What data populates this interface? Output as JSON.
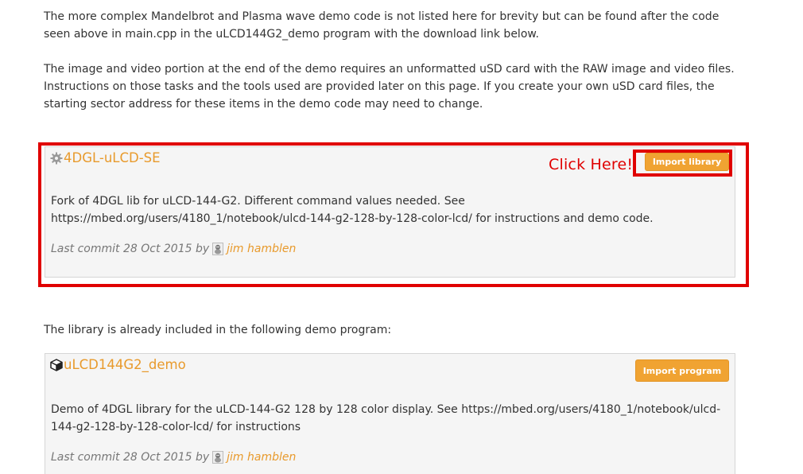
{
  "intro": {
    "paragraph1": "The more complex Mandelbrot and Plasma wave demo code is not listed here for brevity but can be found after the code seen above in main.cpp in the uLCD144G2_demo program with the download link below.",
    "paragraph2": "The image and video portion at the end of the demo requires an unformatted uSD card with the RAW image and video files. Instructions on those tasks and the tools used are provided later on this page. If you create your own uSD card files, the starting sector address for these items in the demo code may need to change."
  },
  "library_card": {
    "icon": "gear-icon",
    "title": "4DGL-uLCD-SE",
    "button_label": "Import library",
    "annotation": "Click Here!",
    "description": "Fork of 4DGL lib for uLCD-144-G2. Different command values needed. See https://mbed.org/users/4180_1/notebook/ulcd-144-g2-128-by-128-color-lcd/ for instructions and demo code.",
    "commit_prefix": "Last commit 28 Oct 2015 by",
    "author": "jim hamblen"
  },
  "included_text": "The library is already included in the following demo program:",
  "program_card": {
    "icon": "cube-icon",
    "title": "uLCD144G2_demo",
    "button_label": "Import program",
    "description": "Demo of 4DGL library for the uLCD-144-G2 128 by 128 color display. See https://mbed.org/users/4180_1/notebook/ulcd-144-g2-128-by-128-color-lcd/ for instructions",
    "commit_prefix": "Last commit 28 Oct 2015 by",
    "author": "jim hamblen"
  },
  "colors": {
    "accent": "#e89a2c",
    "button": "#f0a332",
    "annotation_red": "#e00000",
    "card_bg": "#f5f5f5"
  }
}
